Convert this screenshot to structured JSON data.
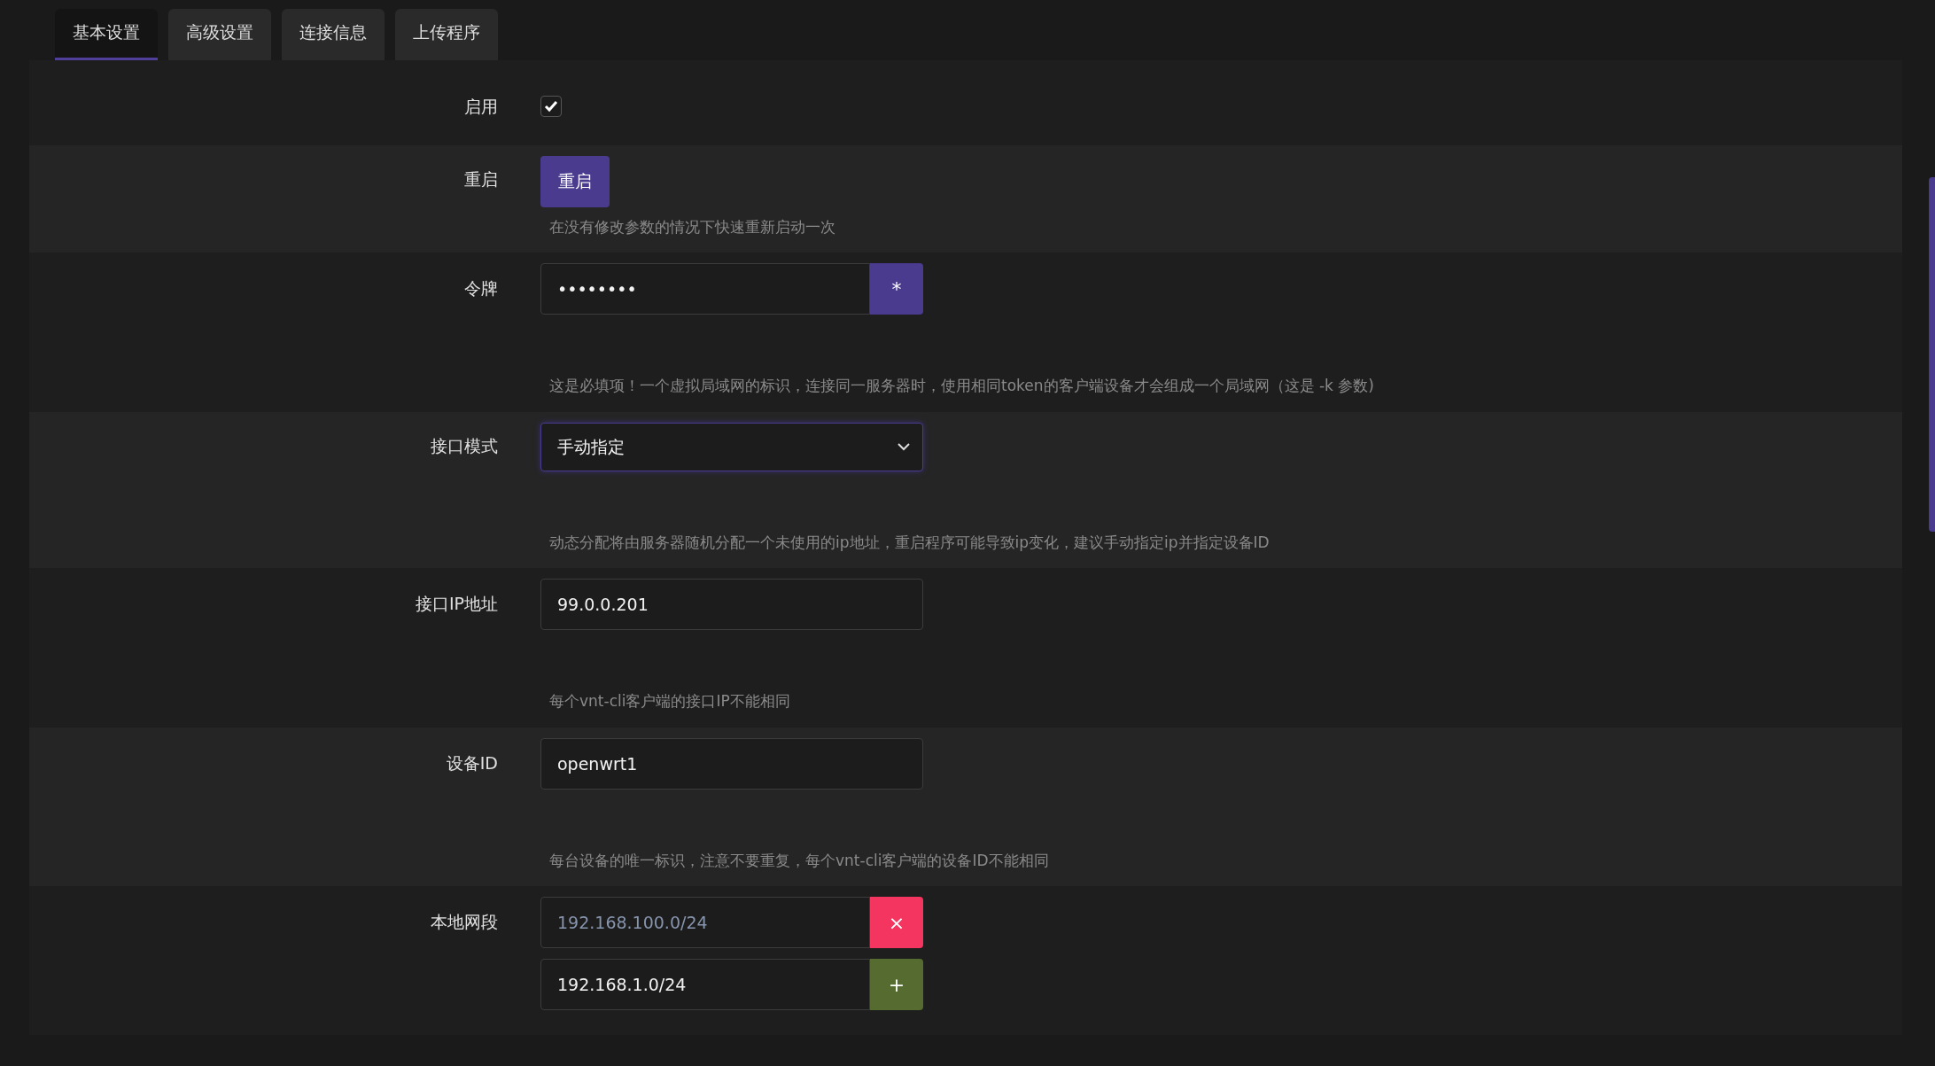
{
  "tabs": [
    {
      "label": "基本设置",
      "selected": true
    },
    {
      "label": "高级设置",
      "selected": false
    },
    {
      "label": "连接信息",
      "selected": false
    },
    {
      "label": "上传程序",
      "selected": false
    }
  ],
  "rows": [
    {
      "kind": "checkbox",
      "label": "启用",
      "checked": true
    },
    {
      "kind": "button",
      "label": "重启",
      "button": "重启",
      "hint": "在没有修改参数的情况下快速重新启动一次"
    },
    {
      "kind": "password",
      "label": "令牌",
      "value": "••••••••",
      "button": "*",
      "hint": "这是必填项！一个虚拟局域网的标识，连接同一服务器时，使用相同token的客户端设备才会组成一个局域网（这是 -k 参数)"
    },
    {
      "kind": "select",
      "label": "接口模式",
      "value": "手动指定",
      "hint": "动态分配将由服务器随机分配一个未使用的ip地址，重启程序可能导致ip变化，建议手动指定ip并指定设备ID"
    },
    {
      "kind": "text",
      "label": "接口IP地址",
      "value": "99.0.0.201",
      "hint": "每个vnt-cli客户端的接口IP不能相同"
    },
    {
      "kind": "text",
      "label": "设备ID",
      "value": "openwrt1",
      "hint": "每台设备的唯一标识，注意不要重复，每个vnt-cli客户端的设备ID不能相同"
    },
    {
      "kind": "list",
      "label": "本地网段",
      "items": [
        {
          "kind": "remove",
          "value": "192.168.100.0/24",
          "readonly": true,
          "button": "×"
        },
        {
          "kind": "add",
          "value": "192.168.1.0/24",
          "readonly": false,
          "button": "+"
        }
      ]
    }
  ]
}
